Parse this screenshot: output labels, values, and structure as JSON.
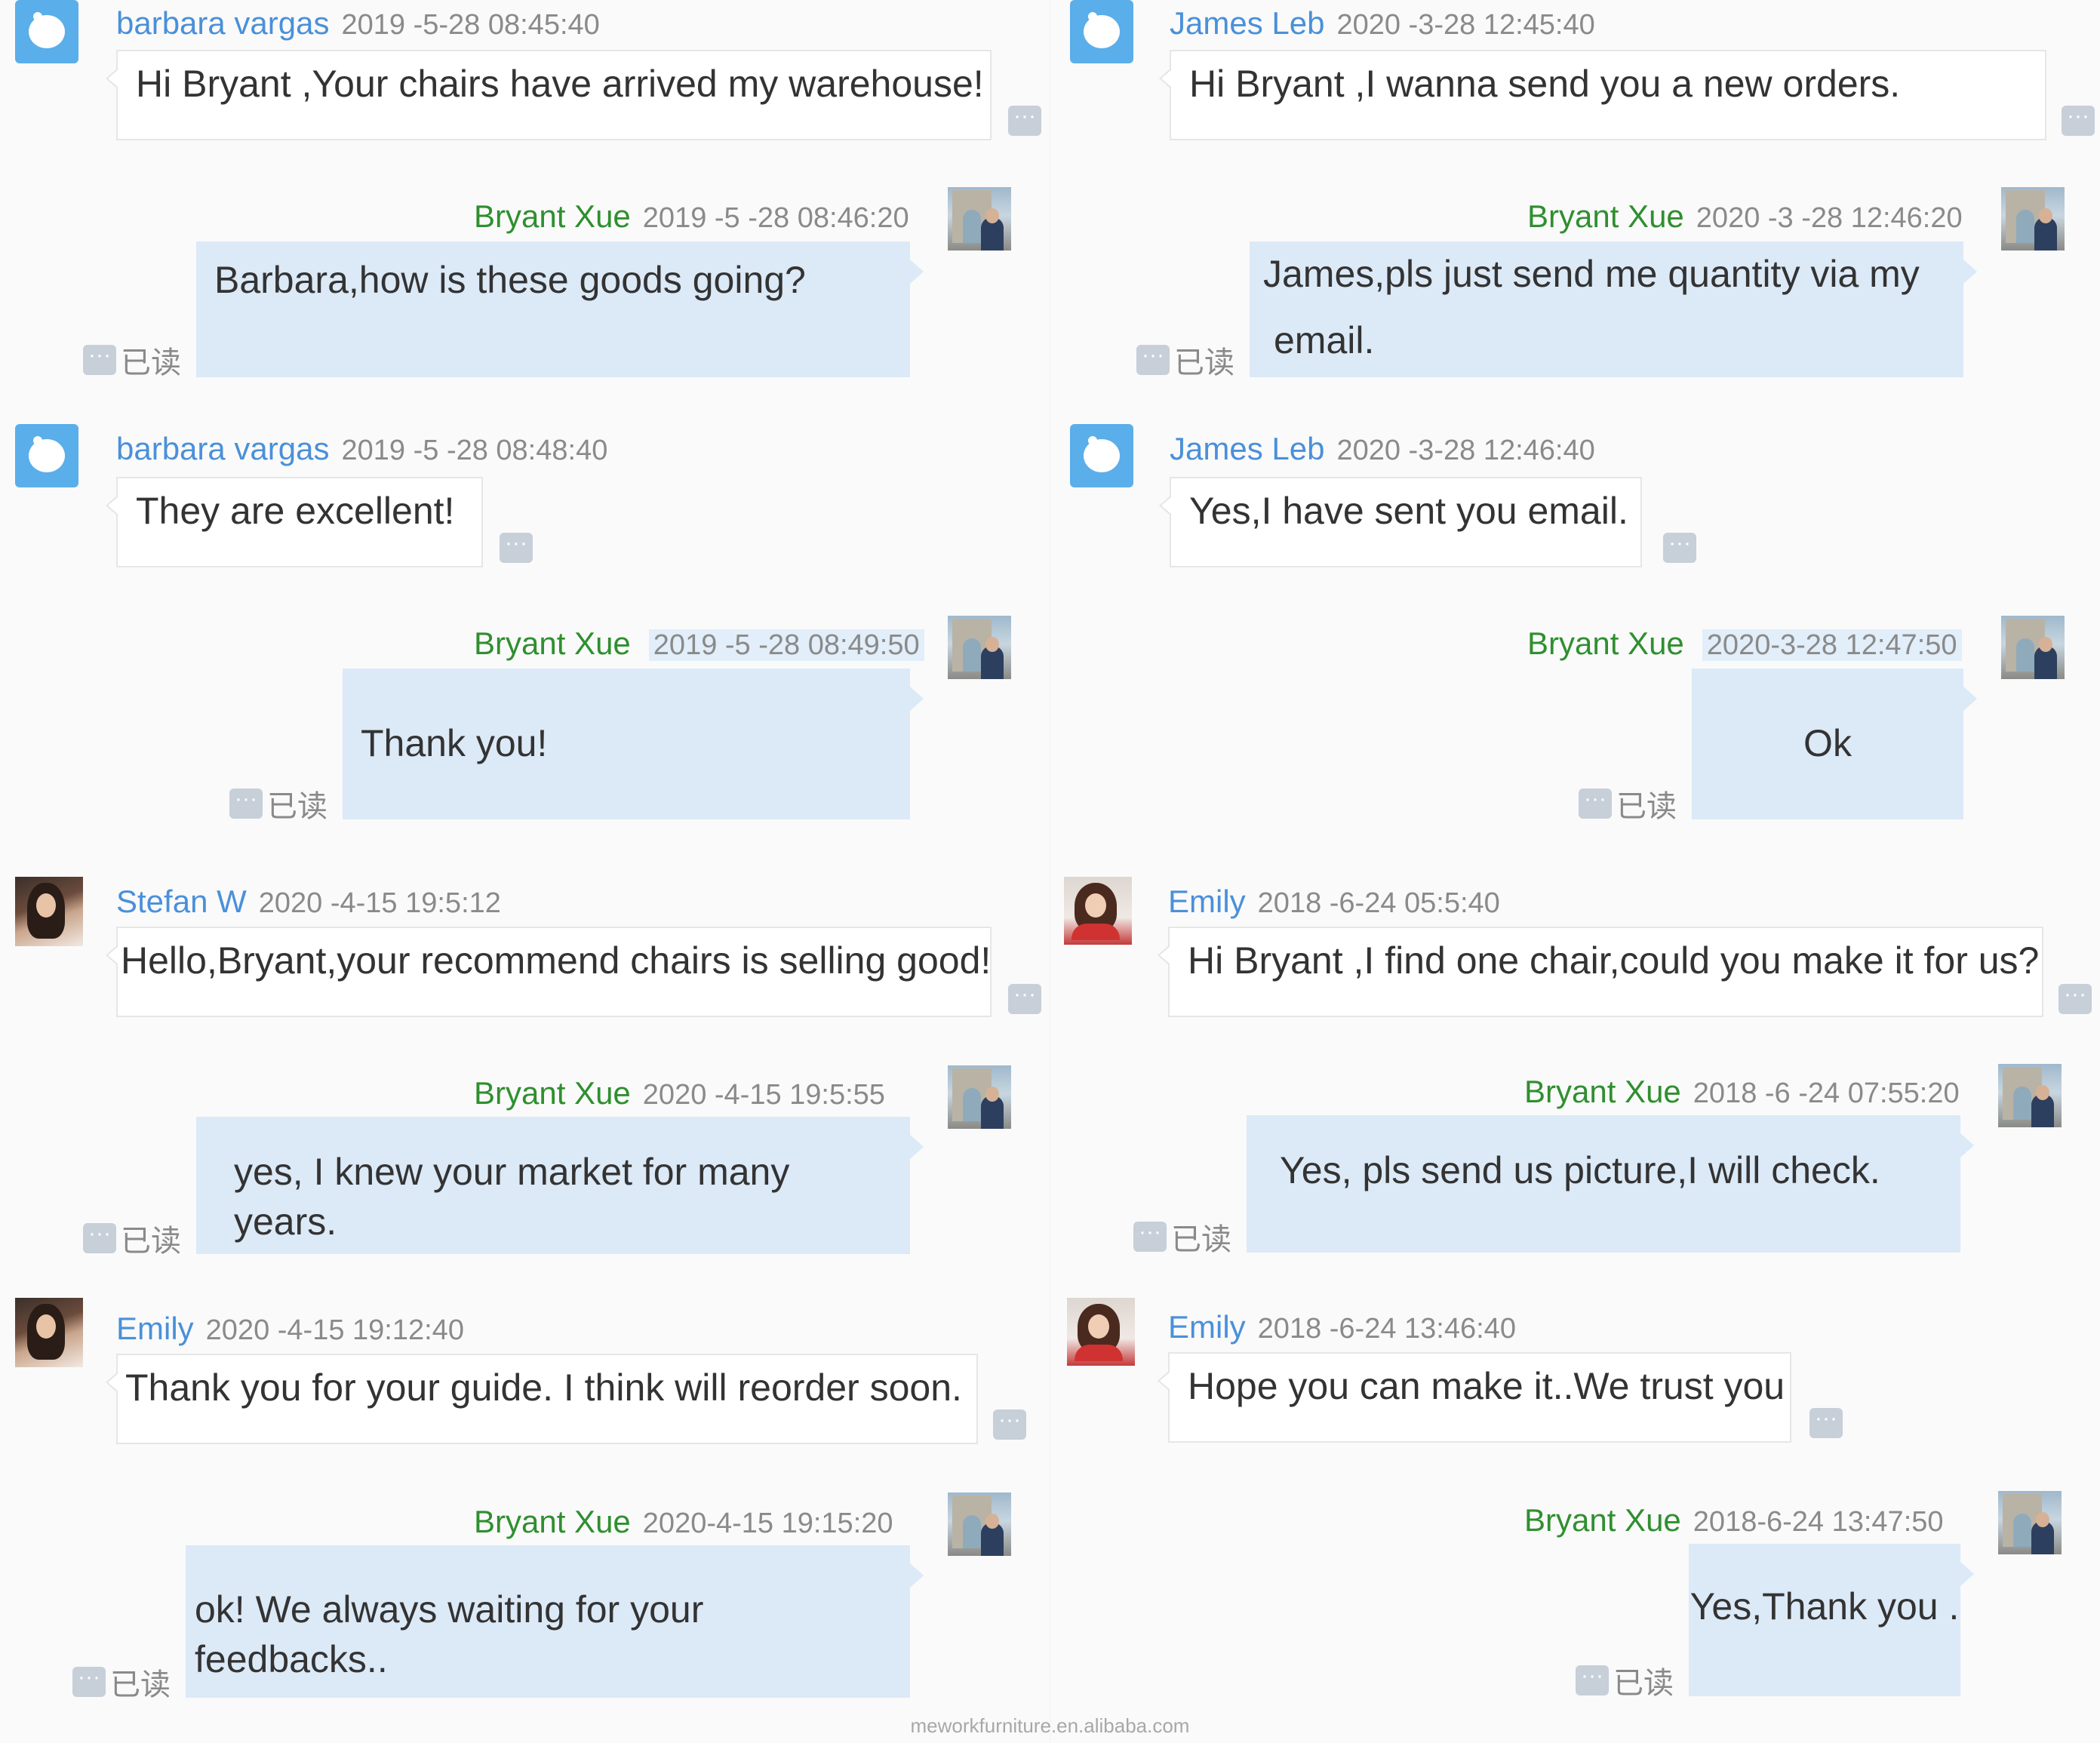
{
  "left": {
    "m1": {
      "name": "barbara vargas",
      "time": "2019 -5-28 08:45:40",
      "text": "Hi Bryant ,Your chairs have arrived my warehouse!"
    },
    "r1": {
      "name": "Bryant Xue",
      "time": "2019 -5 -28 08:46:20",
      "text": "Barbara,how is these goods going?",
      "status": "已读"
    },
    "m2": {
      "name": "barbara vargas",
      "time": "2019 -5 -28 08:48:40",
      "text": "They are excellent!"
    },
    "r2": {
      "name": "Bryant Xue",
      "time": "2019 -5 -28 08:49:50",
      "text": "Thank you!",
      "status": "已读"
    },
    "m3": {
      "name": "Stefan W",
      "time": "2020 -4-15 19:5:12",
      "text": "Hello,Bryant,your recommend chairs is selling good!"
    },
    "r3": {
      "name": "Bryant Xue",
      "time": "2020 -4-15 19:5:55",
      "text": "yes, I knew your market for many years.",
      "status": "已读"
    },
    "m4": {
      "name": "Emily",
      "time": "2020 -4-15 19:12:40",
      "text": "Thank you for your guide. I think will reorder soon."
    },
    "r4": {
      "name": "Bryant Xue",
      "time": "2020-4-15 19:15:20",
      "text": "ok! We always waiting for your feedbacks..",
      "status": "已读"
    }
  },
  "right": {
    "m1": {
      "name": "James Leb",
      "time": "2020 -3-28 12:45:40",
      "text": "Hi Bryant ,I wanna send you a new orders."
    },
    "r1": {
      "name": "Bryant Xue",
      "time": "2020 -3 -28 12:46:20",
      "text_line1": "James,pls just send me quantity via my",
      "text_line2": "email.",
      "status": "已读"
    },
    "m2": {
      "name": "James Leb",
      "time": "2020 -3-28 12:46:40",
      "text": "Yes,I have sent you email."
    },
    "r2": {
      "name": "Bryant Xue",
      "time": "2020-3-28 12:47:50",
      "text": "Ok",
      "status": "已读"
    },
    "m3": {
      "name": "Emily",
      "time": "2018 -6-24 05:5:40",
      "text": "Hi Bryant ,I find one chair,could you make it for us?"
    },
    "r3": {
      "name": "Bryant Xue",
      "time": "2018 -6 -24 07:55:20",
      "text": "Yes, pls send us picture,I will check.",
      "status": "已读"
    },
    "m4": {
      "name": "Emily",
      "time": "2018 -6-24 13:46:40",
      "text": "Hope you can make it..We trust you"
    },
    "r4": {
      "name": "Bryant Xue",
      "time": "2018-6-24 13:47:50",
      "text": "Yes,Thank you .",
      "status": "已读"
    }
  },
  "ui": {
    "more_glyph": "···",
    "watermark": "meworkfurniture.en.alibaba.com"
  },
  "colors": {
    "incoming_name": "#4a90d9",
    "outgoing_name": "#2f8f2f",
    "outgoing_bubble": "#dce9f7",
    "more_button": "#c7cfd9"
  }
}
